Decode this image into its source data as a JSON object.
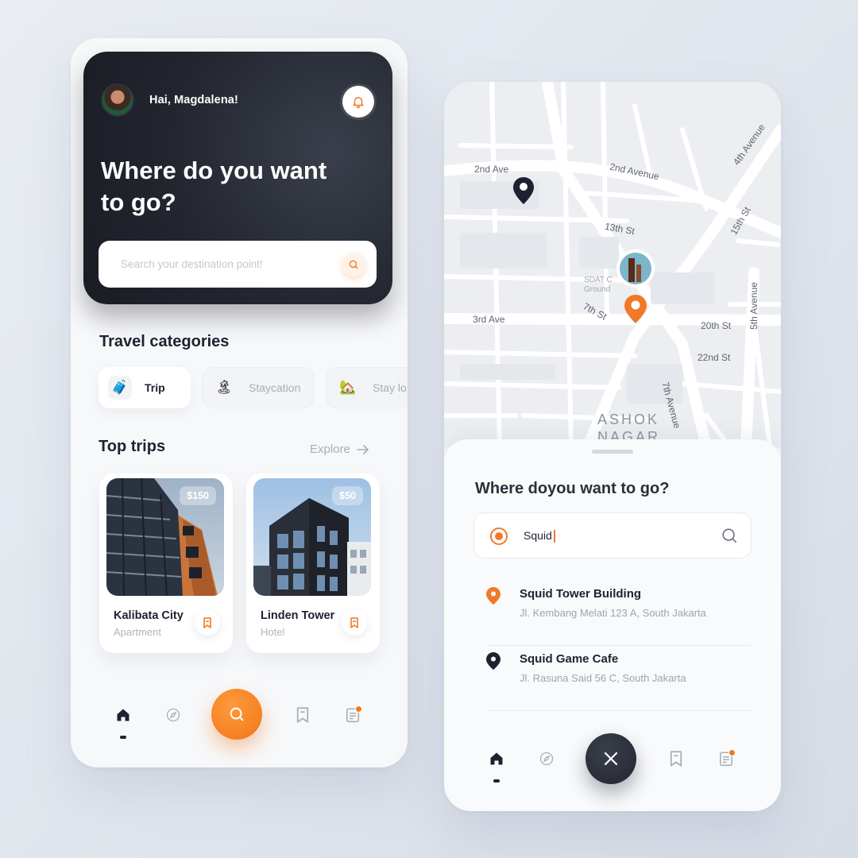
{
  "home": {
    "greeting": "Hai, Magdalena!",
    "hero_title": "Where do you want to go?",
    "search_placeholder": "Search your destination point!",
    "categories_title": "Travel categories",
    "categories": [
      {
        "label": "Trip",
        "icon": "suitcase-icon",
        "selected": true
      },
      {
        "label": "Staycation",
        "icon": "beach-icon",
        "selected": false
      },
      {
        "label": "Stay lo",
        "icon": "house-icon",
        "selected": false
      }
    ],
    "top_trips_title": "Top trips",
    "explore_label": "Explore",
    "trips": [
      {
        "name": "Kalibata City",
        "type": "Apartment",
        "price": "$150"
      },
      {
        "name": "Linden Tower",
        "type": "Hotel",
        "price": "$50"
      }
    ]
  },
  "map": {
    "streets": [
      "2nd Ave",
      "2nd Avenue",
      "4th Avenue",
      "13th St",
      "15th St",
      "3rd Ave",
      "7th St",
      "20th St",
      "22nd St",
      "5th Avenue",
      "7th Avenue"
    ],
    "district": "ASHOK NAGAR",
    "place_label": "SDAT C Ground",
    "sheet_title": "Where doyou want to go?",
    "search_value": "Squid",
    "results": [
      {
        "name": "Squid Tower Building",
        "address": "Jl. Kembang Melati 123 A, South Jakarta",
        "pin_color": "#f0792a"
      },
      {
        "name": "Squid Game Cafe",
        "address": "Jl. Rasuna Said 56 C, South Jakarta",
        "pin_color": "#1e2230"
      }
    ]
  },
  "nav": {
    "items": [
      "home-icon",
      "compass-icon",
      "search-icon",
      "bookmark-icon",
      "notes-icon"
    ],
    "close_icon": "close-icon"
  },
  "colors": {
    "accent": "#f07a20",
    "dark": "#23262f",
    "background": "#e4e8ef"
  }
}
